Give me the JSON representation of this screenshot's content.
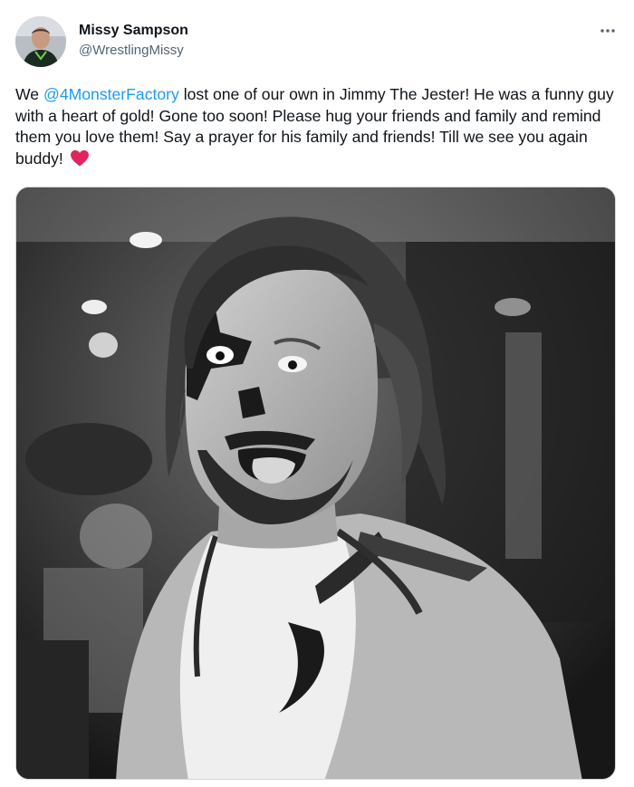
{
  "tweet": {
    "author": {
      "display_name": "Missy Sampson",
      "handle": "@WrestlingMissy"
    },
    "more_icon": "more-horizontal-icon",
    "text": {
      "before_mention": "We ",
      "mention": "@4MonsterFactory",
      "after_mention": " lost one of our own in Jimmy The Jester! He was a funny guy with a heart of gold! Gone too soon! Please hug your friends and family and remind them you love them! Say a prayer for his family and friends! Till we see you again buddy! ",
      "emoji": "red-heart-icon"
    },
    "media": {
      "type": "photo"
    }
  },
  "colors": {
    "mention": "#1d9bf0",
    "handle": "#536471",
    "text": "#0f1419",
    "heart": "#e0245e"
  }
}
